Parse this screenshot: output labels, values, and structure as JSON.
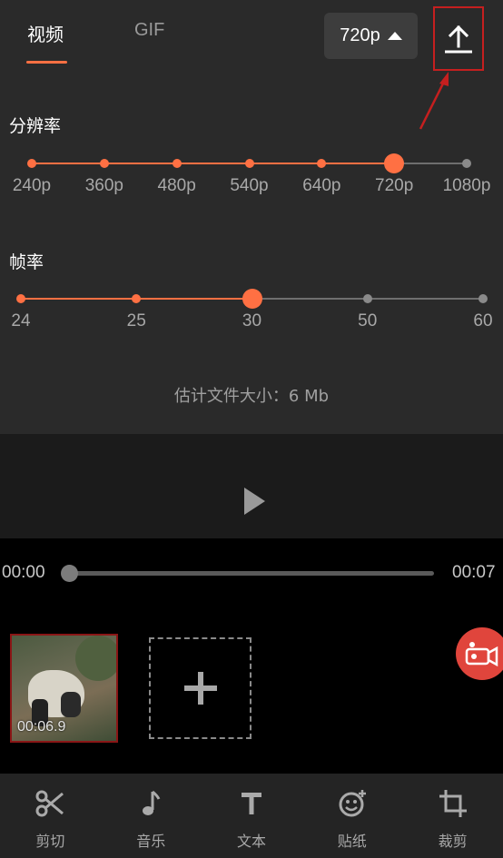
{
  "tabs": {
    "video": "视频",
    "gif": "GIF"
  },
  "resolution_button": {
    "label": "720p",
    "icon": "caret-up-icon"
  },
  "upload_button": {
    "icon": "upload-icon"
  },
  "resolution": {
    "label": "分辨率",
    "options": [
      "240p",
      "360p",
      "480p",
      "540p",
      "640p",
      "720p",
      "1080p"
    ],
    "selected_index": 5
  },
  "framerate": {
    "label": "帧率",
    "options": [
      "24",
      "25",
      "30",
      "50",
      "60"
    ],
    "selected_index": 2
  },
  "file_size": "估计文件大小：6 Mb",
  "player": {
    "current_time": "00:00",
    "end_time": "00:07",
    "progress": 0
  },
  "clip": {
    "duration": "00:06.9"
  },
  "toolbar": [
    {
      "label": "剪切",
      "icon": "scissors-icon"
    },
    {
      "label": "音乐",
      "icon": "music-note-icon"
    },
    {
      "label": "文本",
      "icon": "text-icon"
    },
    {
      "label": "贴纸",
      "icon": "sticker-icon"
    },
    {
      "label": "裁剪",
      "icon": "crop-icon"
    }
  ],
  "colors": {
    "accent": "#ff7043",
    "highlight_box": "#c51f1f",
    "record": "#e0453c"
  }
}
